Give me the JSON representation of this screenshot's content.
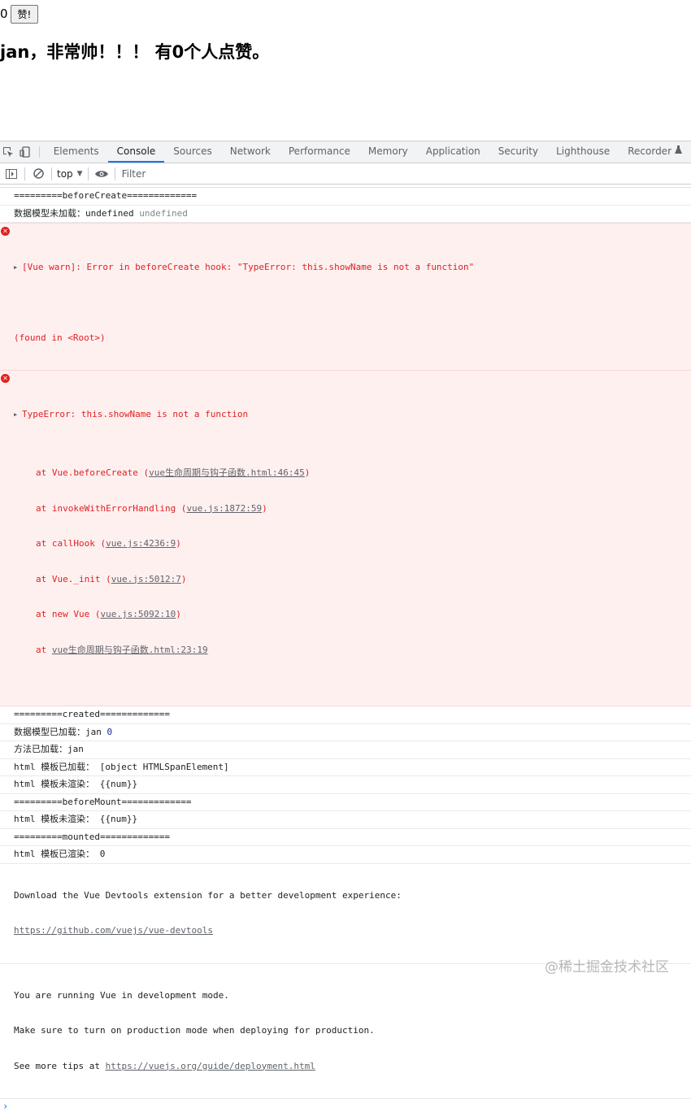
{
  "app": {
    "count": "0",
    "like_button": "赞!",
    "heading": "jan，非常帅！！！ 有0个人点赞。"
  },
  "devtools": {
    "tabs": [
      "Elements",
      "Console",
      "Sources",
      "Network",
      "Performance",
      "Memory",
      "Application",
      "Security",
      "Lighthouse",
      "Recorder"
    ],
    "active_tab": "Console",
    "toolbar": {
      "context": "top",
      "filter_placeholder": "Filter"
    },
    "icons": {
      "inspect": "inspect-element-icon",
      "device": "device-toolbar-icon",
      "sidebar": "sidebar-toggle-icon",
      "clear": "clear-console-icon",
      "eye": "live-expression-eye-icon",
      "dropdown": "chevron-down-icon",
      "recorder": "flask-icon",
      "error": "error-circle-icon",
      "expand": "expand-triangle-icon",
      "prompt": "chevron-right-icon"
    },
    "colors": {
      "accent": "#1a73e8",
      "error_text": "#e02020",
      "error_bg": "#fff0f0"
    }
  },
  "console": {
    "m1": "=========beforeCreate=============",
    "m2_label": "数据模型未加载：",
    "m2_val1": "undefined",
    "m2_val2": "undefined",
    "e1_text": "[Vue warn]: Error in beforeCreate hook: \"TypeError: this.showName is not a function\"",
    "e1_found": "(found in <Root>)",
    "e2_text": "TypeError: this.showName is not a function",
    "e2_frames": [
      {
        "at": "at Vue.beforeCreate (",
        "link": "vue生命周期与钩子函数.html:46:45",
        "end": ")"
      },
      {
        "at": "at invokeWithErrorHandling (",
        "link": "vue.js:1872:59",
        "end": ")"
      },
      {
        "at": "at callHook (",
        "link": "vue.js:4236:9",
        "end": ")"
      },
      {
        "at": "at Vue._init (",
        "link": "vue.js:5012:7",
        "end": ")"
      },
      {
        "at": "at new Vue (",
        "link": "vue.js:5092:10",
        "end": ")"
      },
      {
        "at": "at ",
        "link": "vue生命周期与钩子函数.html:23:19",
        "end": ""
      }
    ],
    "m3": "=========created=============",
    "m4_label": "数据模型已加载：",
    "m4_val1": "jan",
    "m4_val2": "0",
    "m5": "方法已加载：jan",
    "m6": "html 模板已加载： [object HTMLSpanElement]",
    "m7": "html 模板未渲染： {{num}}",
    "m8": "=========beforeMount=============",
    "m9": "html 模板未渲染： {{num}}",
    "m10": "=========mounted=============",
    "m11": "html 模板已渲染： 0",
    "m12_line1": "Download the Vue Devtools extension for a better development experience:",
    "m12_link": "https://github.com/vuejs/vue-devtools",
    "m13_line1": "You are running Vue in development mode.",
    "m13_line2": "Make sure to turn on production mode when deploying for production.",
    "m13_line3_prefix": "See more tips at ",
    "m13_link": "https://vuejs.org/guide/deployment.html"
  },
  "watermark": "@稀土掘金技术社区"
}
